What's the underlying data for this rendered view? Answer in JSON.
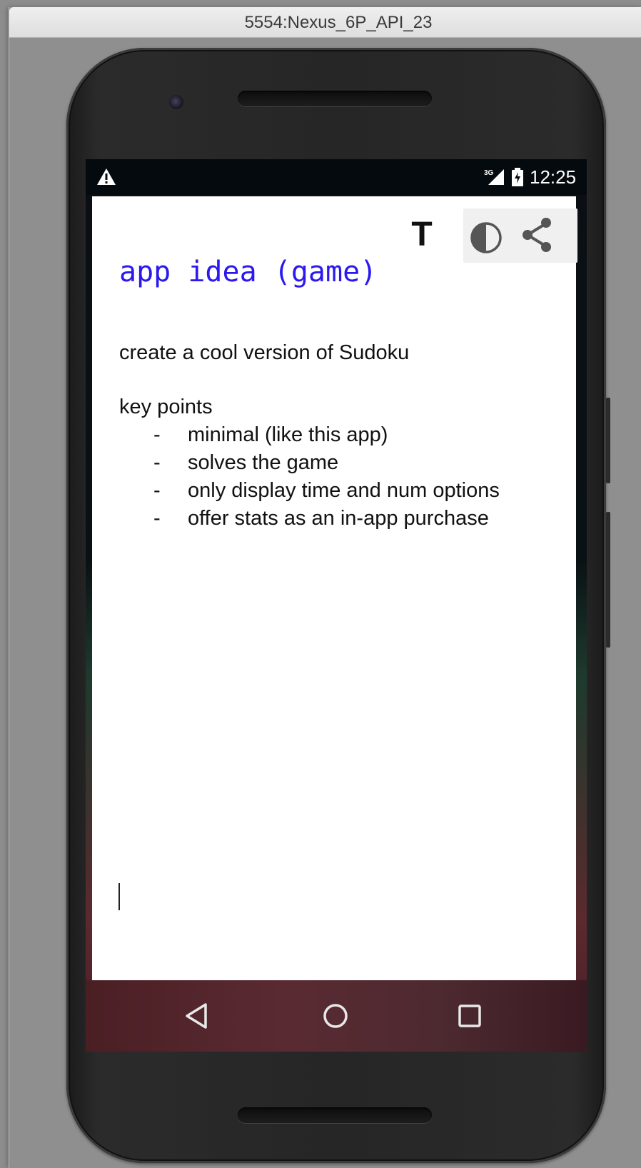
{
  "window": {
    "title": "5554:Nexus_6P_API_23"
  },
  "statusbar": {
    "time": "12:25",
    "network_label": "3G",
    "icons": [
      "warning-icon",
      "signal-icon",
      "battery-icon"
    ]
  },
  "toolbar": {
    "text_button_label": "T",
    "icons": [
      "contrast-icon",
      "share-icon"
    ]
  },
  "note": {
    "title": "app idea (game)",
    "intro": "create a cool version of Sudoku",
    "section_heading": "key points",
    "bullet_marker": "-",
    "points": [
      "minimal (like this app)",
      "solves the game",
      "only display time and num options",
      "offer stats as an in-app purchase"
    ]
  },
  "navbar": {
    "icons": [
      "back-icon",
      "home-icon",
      "recents-icon"
    ]
  },
  "colors": {
    "title_blue": "#2b19f0",
    "body_text": "#111111",
    "statusbar_bg": "#050a0e"
  }
}
